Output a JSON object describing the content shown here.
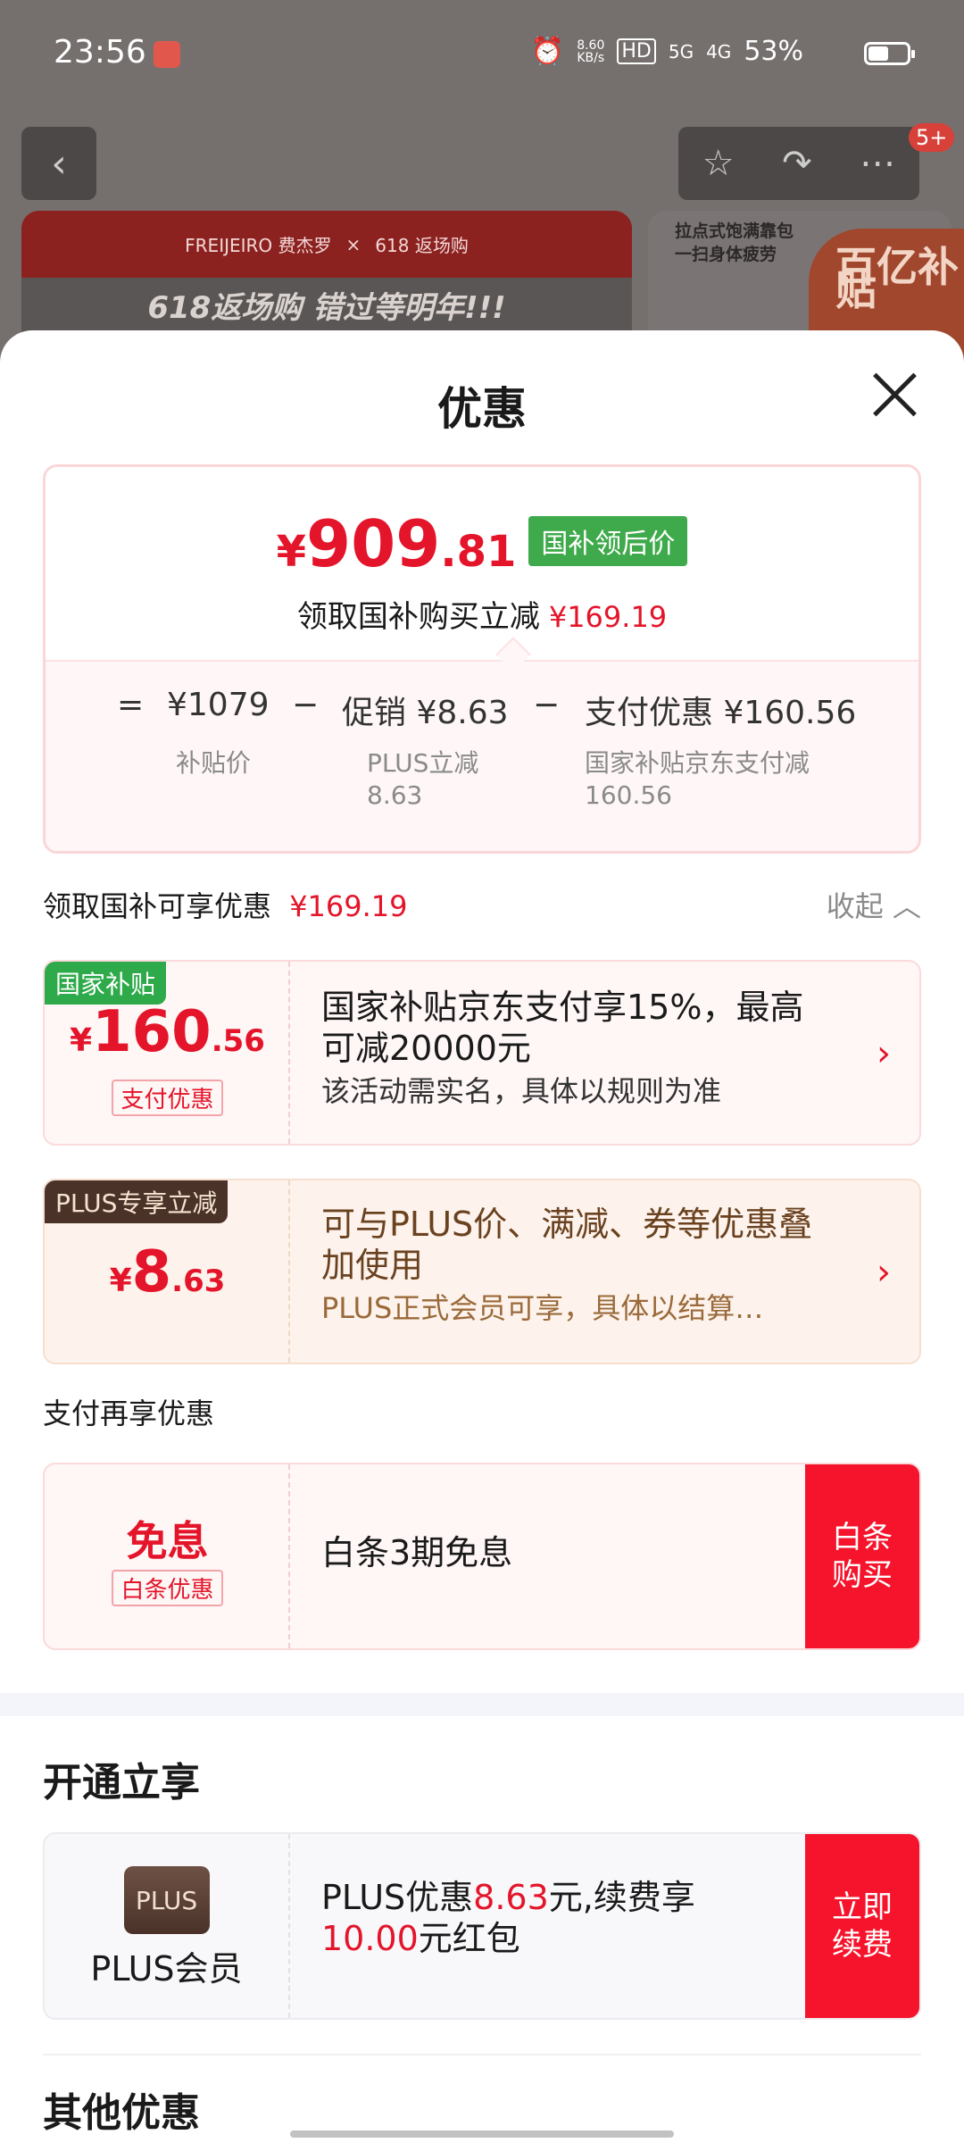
{
  "status_bar": {
    "time": "23:56",
    "net_speed": "8.60\nKB/s",
    "hd": "HD",
    "signal_5g": "5G",
    "signal_4g": "4G",
    "battery": "53%"
  },
  "background": {
    "banner_brand_1": "FREIJEIRO 费杰罗",
    "banner_brand_2": "618 返场购",
    "banner_slogan": "618返场购 错过等明年!!!",
    "card_title": "拉点式饱满靠包\n一扫身体疲劳",
    "card_tag": "百亿补贴",
    "cart_badge": "5+"
  },
  "sheet": {
    "title": "优惠",
    "price_box": {
      "yen": "¥",
      "price_int": "909",
      "price_dec": ".81",
      "tag": "国补领后价",
      "subtitle": "领取国补购买立减",
      "subtitle_amount": "¥169.19",
      "formula": {
        "eq": "=",
        "base": "¥1079",
        "minus1": "−",
        "promo": "促销 ¥8.63",
        "minus2": "−",
        "pay": "支付优惠 ¥160.56"
      },
      "base_label": "补贴价",
      "promo_label_1": "PLUS立减",
      "promo_label_2": "8.63",
      "pay_label_1": "国家补贴京东支付减",
      "pay_label_2": "160.56"
    },
    "guobu_section": {
      "title": "领取国补可享优惠",
      "amount": "¥169.19",
      "collapse": "收起"
    },
    "coupon_guobu": {
      "tag": "国家补贴",
      "yen": "¥",
      "amount_int": "160",
      "amount_dec": ".56",
      "label": "支付优惠",
      "title": "国家补贴京东支付享15%，最高可减20000元",
      "desc": "该活动需实名，具体以规则为准"
    },
    "coupon_plus": {
      "tag": "PLUS专享立减",
      "yen": "¥",
      "amount_int": "8",
      "amount_dec": ".63",
      "title": "可与PLUS价、满减、券等优惠叠加使用",
      "desc": "PLUS正式会员可享，具体以结算…"
    },
    "pay_section_title": "支付再享优惠",
    "coupon_baitiao": {
      "title": "免息",
      "label": "白条优惠",
      "desc": "白条3期免息",
      "button": "白条\n购买"
    },
    "open_section_title": "开通立享",
    "plus_member": {
      "logo": "PLUS",
      "name": "PLUS会员",
      "text_1": "PLUS优惠",
      "amount_1": "8.63",
      "text_2": "元,续费享",
      "amount_2": "10.00",
      "text_3": "元红包",
      "button": "立即\n续费"
    },
    "other_section_title": "其他优惠"
  },
  "colors": {
    "accent_red": "#e4152a",
    "tag_green": "#3faa4b",
    "plus_brown": "#4a3229"
  }
}
